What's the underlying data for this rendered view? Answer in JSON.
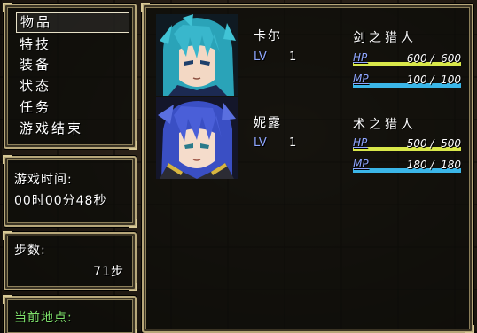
{
  "menu": {
    "items": [
      "物品",
      "特技",
      "装备",
      "状态",
      "任务",
      "游戏结束"
    ],
    "selected_index": 0
  },
  "playtime": {
    "label": "游戏时间:",
    "value": "00时00分48秒"
  },
  "steps": {
    "label": "步数:",
    "value": "71步"
  },
  "location": {
    "label": "当前地点:"
  },
  "party": [
    {
      "name": "卡尔",
      "lv_label": "LV",
      "level": "1",
      "class": "剑之猎人",
      "hp_label": "HP",
      "hp_text": "600 /  600",
      "hp_current": 600,
      "hp_max": 600,
      "mp_label": "MP",
      "mp_text": "100 /  100",
      "mp_current": 100,
      "mp_max": 100,
      "portrait": "teal-haired-boy-portrait"
    },
    {
      "name": "妮露",
      "lv_label": "LV",
      "level": "1",
      "class": "术之猎人",
      "hp_label": "HP",
      "hp_text": "500 /  500",
      "hp_current": 500,
      "hp_max": 500,
      "mp_label": "MP",
      "mp_text": "180 /  180",
      "mp_current": 180,
      "mp_max": 180,
      "portrait": "blue-haired-girl-portrait"
    }
  ],
  "colors": {
    "hp_gauge": "#d9e84a",
    "mp_gauge": "#3bb6e8",
    "window_border": "#b7a77a",
    "lv_label": "#8fa6ff",
    "location_label": "#7ee06a"
  }
}
